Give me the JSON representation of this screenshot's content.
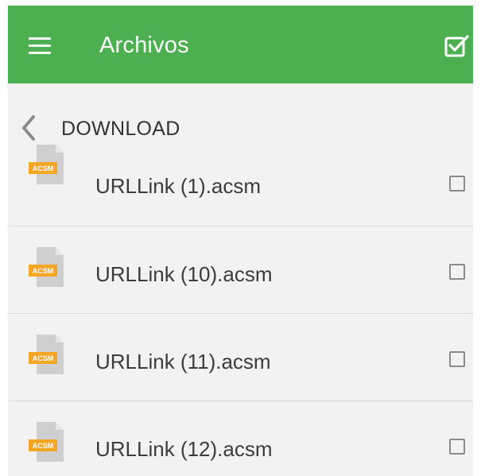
{
  "appbar": {
    "title": "Archivos",
    "menu_icon": "menu-icon",
    "action_icon": "select-all-icon",
    "color": "#4caf50"
  },
  "path": {
    "back_icon": "back-icon",
    "label": "DOWNLOAD"
  },
  "files": [
    {
      "name": "URLLink (1).acsm",
      "badge": "ACSM",
      "checked": false
    },
    {
      "name": "URLLink (10).acsm",
      "badge": "ACSM",
      "checked": false
    },
    {
      "name": "URLLink (11).acsm",
      "badge": "ACSM",
      "checked": false
    },
    {
      "name": "URLLink (12).acsm",
      "badge": "ACSM",
      "checked": false
    }
  ],
  "colors": {
    "background": "#f2f2f2",
    "text": "#3c3c3c",
    "divider": "#dcdcdc",
    "badge": "#f5a623"
  }
}
